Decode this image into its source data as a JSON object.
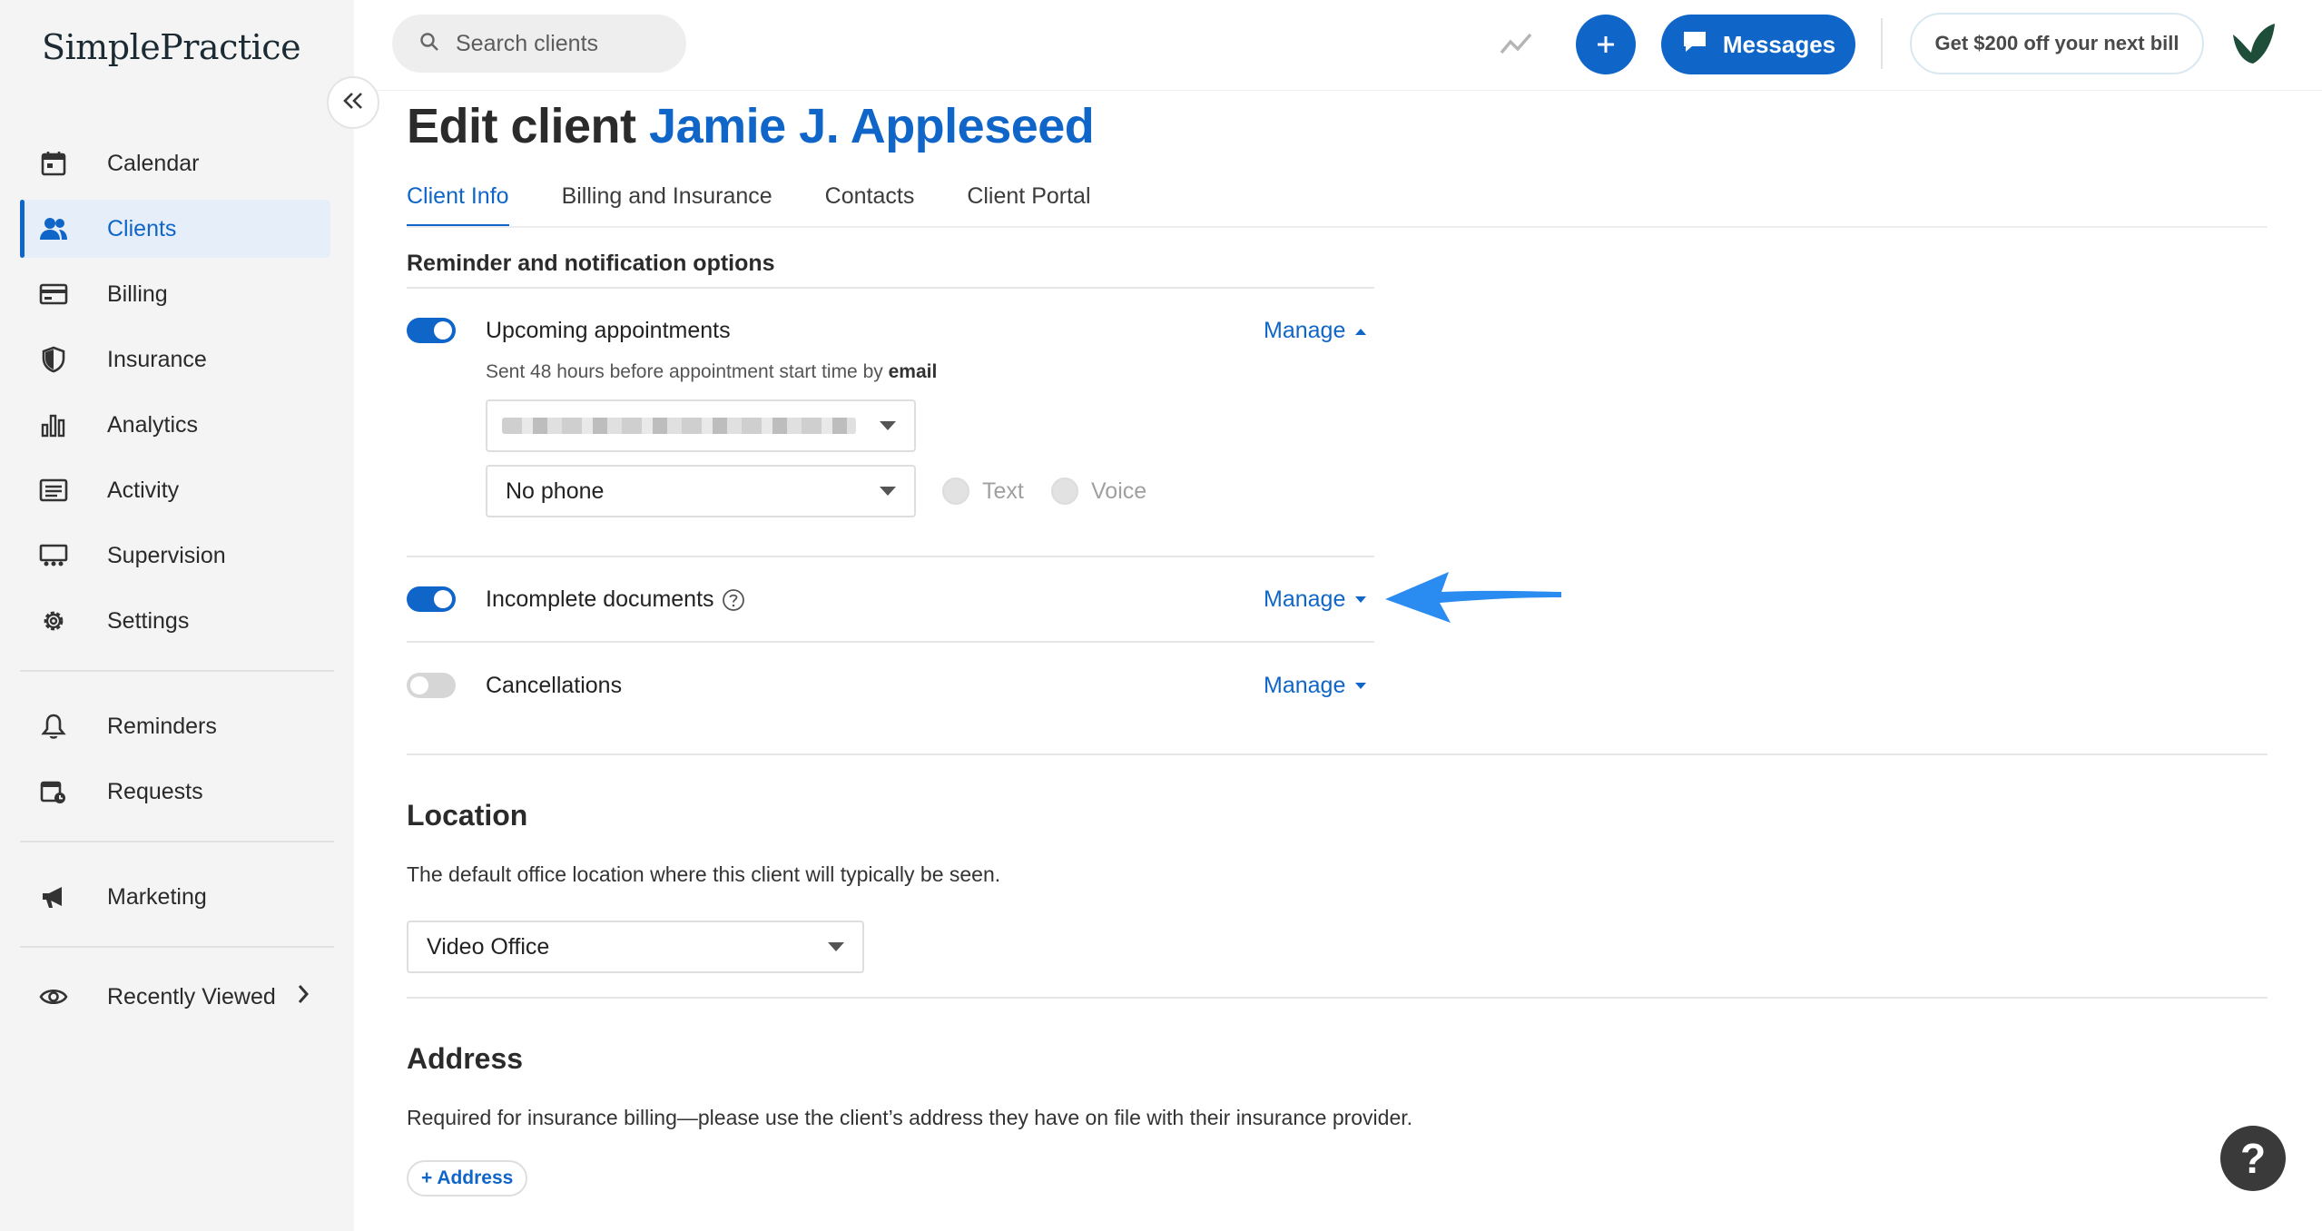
{
  "app": {
    "logo_text": "SimplePractice"
  },
  "sidebar": {
    "items": [
      {
        "label": "Calendar",
        "icon": "calendar-icon"
      },
      {
        "label": "Clients",
        "icon": "clients-icon",
        "active": true
      },
      {
        "label": "Billing",
        "icon": "billing-icon"
      },
      {
        "label": "Insurance",
        "icon": "shield-icon"
      },
      {
        "label": "Analytics",
        "icon": "bar-chart-icon"
      },
      {
        "label": "Activity",
        "icon": "activity-list-icon"
      },
      {
        "label": "Supervision",
        "icon": "supervision-icon"
      },
      {
        "label": "Settings",
        "icon": "gear-icon"
      },
      {
        "label": "Reminders",
        "icon": "bell-icon"
      },
      {
        "label": "Requests",
        "icon": "calendar-request-icon"
      },
      {
        "label": "Marketing",
        "icon": "megaphone-icon"
      },
      {
        "label": "Recently Viewed",
        "icon": "eye-icon"
      }
    ]
  },
  "topbar": {
    "search_placeholder": "Search clients",
    "messages_label": "Messages",
    "promo_label": "Get $200 off your next bill"
  },
  "header": {
    "title_prefix": "Edit client",
    "client_name": "Jamie J. Appleseed"
  },
  "tabs": [
    {
      "label": "Client Info",
      "active": true
    },
    {
      "label": "Billing and Insurance"
    },
    {
      "label": "Contacts"
    },
    {
      "label": "Client Portal"
    }
  ],
  "reminders": {
    "section_title": "Reminder and notification options",
    "manage_label": "Manage",
    "upcoming": {
      "label": "Upcoming appointments",
      "enabled": true,
      "description_prefix": "Sent 48 hours before appointment start time by",
      "description_channel": "email",
      "phone_select_value": "No phone",
      "text_option": "Text",
      "voice_option": "Voice"
    },
    "incomplete": {
      "label": "Incomplete documents",
      "enabled": true
    },
    "cancellations": {
      "label": "Cancellations",
      "enabled": false
    }
  },
  "location": {
    "title": "Location",
    "description": "The default office location where this client will typically be seen.",
    "select_value": "Video Office"
  },
  "address": {
    "title": "Address",
    "description": "Required for insurance billing—please use the client’s address they have on file with their insurance provider.",
    "add_label": "+ Address"
  },
  "help_label": "?",
  "colors": {
    "accent": "#1066c8",
    "arrow": "#2a8cf0"
  }
}
